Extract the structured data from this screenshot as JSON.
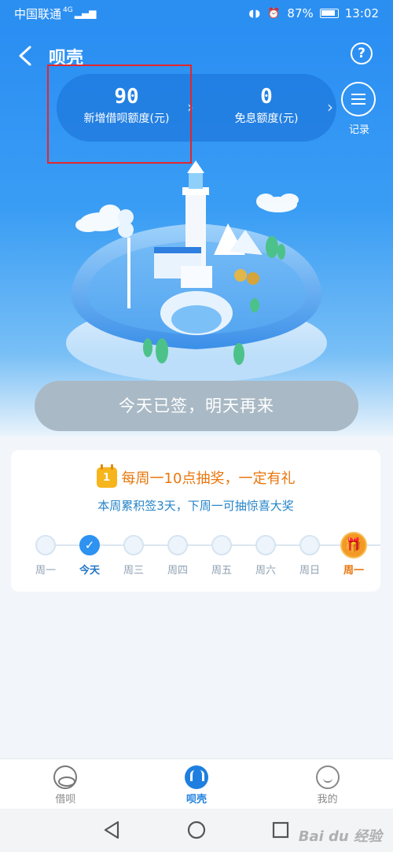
{
  "status_bar": {
    "carrier": "中国联通",
    "network": "4G",
    "battery": "87%",
    "time": "13:02"
  },
  "header": {
    "title": "呗壳"
  },
  "stats": [
    {
      "value": "90",
      "label": "新增借呗额度(元)"
    },
    {
      "value": "0",
      "label": "免息额度(元)"
    }
  ],
  "record": {
    "label": "记录"
  },
  "signin": {
    "button_label": "今天已签，明天再来"
  },
  "weekly": {
    "promo_title": "每周一10点抽奖，一定有礼",
    "calendar_number": "1",
    "promo_sub": "本周累积签3天，下周一可抽惊喜大奖",
    "days": [
      {
        "label": "周一",
        "state": "pending"
      },
      {
        "label": "今天",
        "state": "done"
      },
      {
        "label": "周三",
        "state": "pending"
      },
      {
        "label": "周四",
        "state": "pending"
      },
      {
        "label": "周五",
        "state": "pending"
      },
      {
        "label": "周六",
        "state": "pending"
      },
      {
        "label": "周日",
        "state": "pending"
      },
      {
        "label": "周一",
        "state": "gift"
      }
    ]
  },
  "tabs": [
    {
      "label": "借呗",
      "active": false
    },
    {
      "label": "呗壳",
      "active": true
    },
    {
      "label": "我的",
      "active": false
    }
  ],
  "watermark": "Bai du 经验",
  "colors": {
    "primary": "#2b8ff2",
    "accent_orange": "#e9760c",
    "highlight_box": "#e4262b",
    "signed_button": "#a9b9c5"
  }
}
